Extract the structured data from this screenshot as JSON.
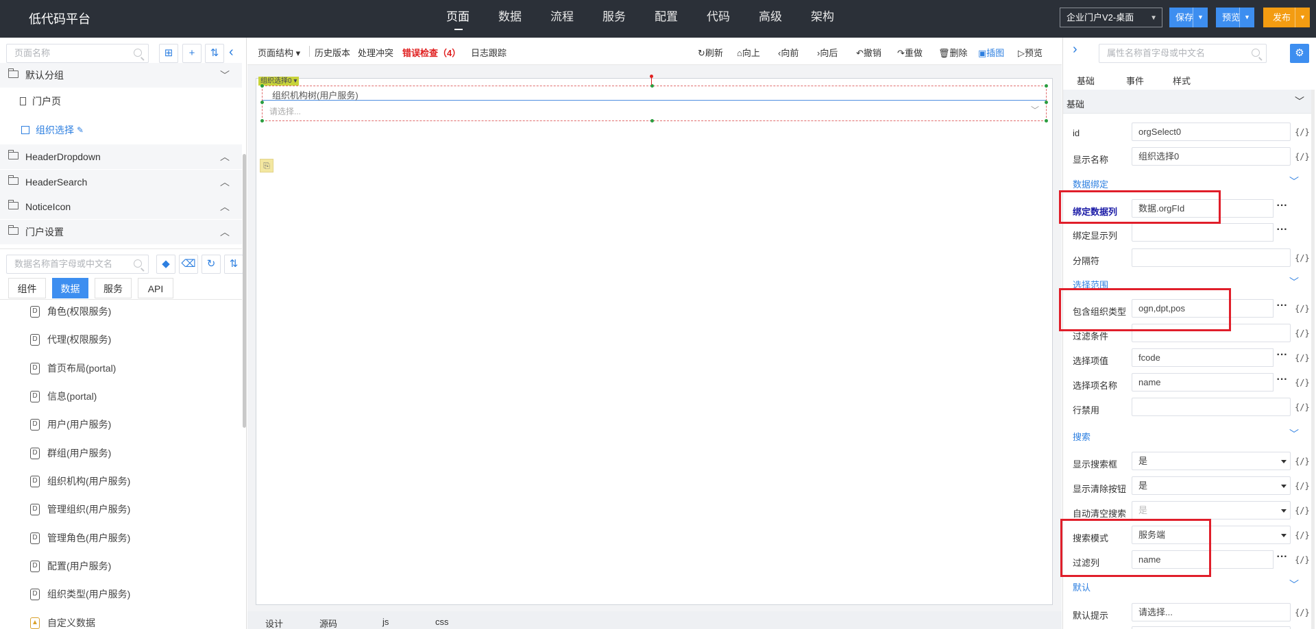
{
  "app": {
    "title": "低代码平台"
  },
  "topnav": [
    "页面",
    "数据",
    "流程",
    "服务",
    "配置",
    "代码",
    "高级",
    "架构"
  ],
  "topright": {
    "project": "企业门户V2-桌面",
    "save": "保存",
    "preview": "预览",
    "publish": "发布"
  },
  "colors": {
    "topbar": "#2b3038",
    "primary": "#3d8ef0",
    "publish": "#f39c12",
    "error": "#e02020",
    "highlight": "#e01e2a"
  },
  "sidebar": {
    "page_search_placeholder": "页面名称",
    "tree": [
      {
        "label": "默认分组",
        "expanded": true
      },
      {
        "label": "门户页"
      },
      {
        "label": "组织选择"
      },
      {
        "label": "HeaderDropdown"
      },
      {
        "label": "HeaderSearch"
      },
      {
        "label": "NoticeIcon"
      },
      {
        "label": "门户设置"
      }
    ],
    "data_search_placeholder": "数据名称首字母或中文名",
    "tabs": [
      "组件",
      "数据",
      "服务",
      "API"
    ],
    "active_tab": "数据",
    "data_items": [
      "角色(权限服务)",
      "代理(权限服务)",
      "首页布局(portal)",
      "信息(portal)",
      "用户(用户服务)",
      "群组(用户服务)",
      "组织机构(用户服务)",
      "管理组织(用户服务)",
      "管理角色(用户服务)",
      "配置(用户服务)",
      "组织类型(用户服务)",
      "自定义数据"
    ]
  },
  "toolbar": {
    "page_structure": "页面结构",
    "history": "历史版本",
    "conflict": "处理冲突",
    "error_check": "错误检查（4）",
    "log": "日志跟踪",
    "refresh": "刷新",
    "up": "向上",
    "forward": "向前",
    "backward": "向后",
    "undo": "撤销",
    "redo": "重做",
    "delete": "删除",
    "insert": "插图",
    "preview": "预览"
  },
  "canvas": {
    "component_tag": "组织选择0",
    "field_label": "组织机构树(用户服务)",
    "field_placeholder": "请选择..."
  },
  "bottom_tabs": [
    "设计",
    "源码",
    "js",
    "css"
  ],
  "props": {
    "search_placeholder": "属性名称首字母或中文名",
    "tabs": [
      "基础",
      "事件",
      "样式"
    ],
    "basic_header": "基础",
    "fx": "{/}",
    "rows": {
      "id": {
        "label": "id",
        "value": "orgSelect0"
      },
      "display_name": {
        "label": "显示名称",
        "value": "组织选择0"
      },
      "bind_col": {
        "label": "绑定数据列",
        "value": "数据.orgFId"
      },
      "bind_display": {
        "label": "绑定显示列",
        "value": ""
      },
      "separator": {
        "label": "分隔符",
        "value": ""
      },
      "org_types": {
        "label": "包含组织类型",
        "value": "ogn,dpt,pos"
      },
      "filter_cond": {
        "label": "过滤条件",
        "value": ""
      },
      "option_value": {
        "label": "选择项值",
        "value": "fcode"
      },
      "option_name": {
        "label": "选择项名称",
        "value": "name"
      },
      "row_disabled": {
        "label": "行禁用",
        "value": ""
      },
      "show_search": {
        "label": "显示搜索框",
        "value": "是"
      },
      "show_clear": {
        "label": "显示清除按钮",
        "value": "是"
      },
      "auto_clear": {
        "label": "自动清空搜索",
        "value": "是"
      },
      "search_mode": {
        "label": "搜索模式",
        "value": "服务端"
      },
      "filter_col": {
        "label": "过滤列",
        "value": "name"
      },
      "default_hint": {
        "label": "默认提示",
        "value": "请选择..."
      }
    },
    "sections": {
      "data_binding": "数据绑定",
      "select_range": "选择范围",
      "search": "搜索",
      "default": "默认"
    }
  }
}
